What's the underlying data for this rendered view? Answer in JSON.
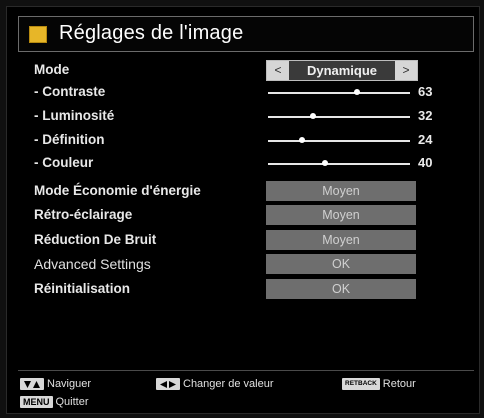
{
  "header": {
    "title": "Réglages de l'image",
    "icon": "picture-settings-icon"
  },
  "mode": {
    "label": "Mode",
    "value": "Dynamique",
    "left_arrow": "<",
    "right_arrow": ">"
  },
  "sliders": [
    {
      "label": "- Contraste",
      "value": "63"
    },
    {
      "label": "- Luminosité",
      "value": "32"
    },
    {
      "label": "- Définition",
      "value": "24"
    },
    {
      "label": "- Couleur",
      "value": "40"
    }
  ],
  "options": [
    {
      "label": "Mode Économie d'énergie",
      "value": "Moyen"
    },
    {
      "label": "Rétro-éclairage",
      "value": "Moyen"
    },
    {
      "label": "Réduction De Bruit",
      "value": "Moyen"
    },
    {
      "label": "Advanced Settings",
      "value": "OK"
    },
    {
      "label": "Réinitialisation",
      "value": "OK"
    }
  ],
  "footer": {
    "navigate": "Naviguer",
    "change_value": "Changer de valeur",
    "return_key": "RETBACK",
    "return": "Retour",
    "menu_key": "MENU",
    "quit": "Quitter"
  },
  "colors": {
    "accent_icon": "#e7b628",
    "option_box": "#6e6e6e",
    "mode_box_inner": "#3a3a3a"
  }
}
